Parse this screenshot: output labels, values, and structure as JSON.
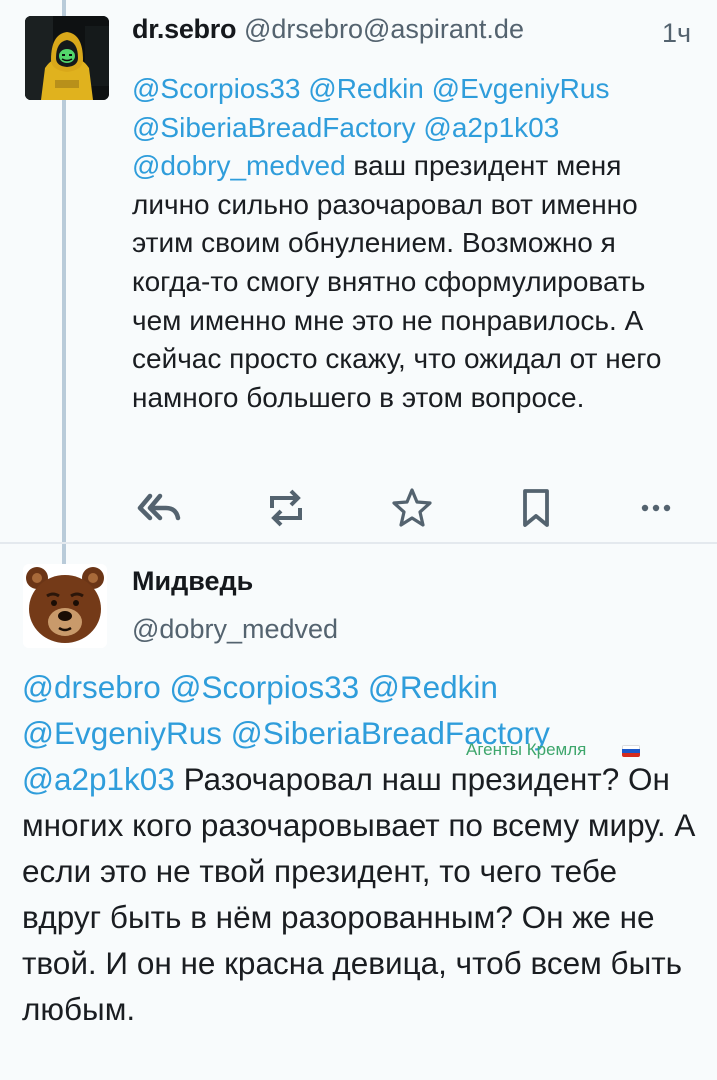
{
  "post": {
    "author_name": "dr.sebro",
    "author_handle": "@drsebro@aspirant.de",
    "time": "1ч",
    "mentions_line1": "@Scorpios33 @Redkin @EvgeniyRus",
    "mentions_line2": "@SiberiaBreadFactory @a2p1k03",
    "mention_inline": "@dobry_medved",
    "text": " ваш президент меня лично сильно разочаровал вот именно этим своим обнулением. Возможно я когда-то смогу внятно сформулировать чем именно мне это не понравилось. А сейчас просто скажу, что ожидал от него намного большего в этом вопросе."
  },
  "actions": {
    "icons": [
      "reply-all-icon",
      "boost-icon",
      "favourite-icon",
      "bookmark-icon",
      "more-icon"
    ]
  },
  "reply": {
    "author_name": "Мидведь",
    "author_handle": "@dobry_medved",
    "mentions_line1": "@drsebro @Scorpios33 @Redkin",
    "mentions_line2": "@EvgeniyRus @SiberiaBreadFactory",
    "mention_inline": "@a2p1k03",
    "text": " Разочаровал наш президент? Он многих кого разочаровывает по всему миру. А если это не твой президент, то чего тебе вдруг быть в нём разорованным? Он же не твой. И он не красна девица, чтоб всем быть любым."
  },
  "watermark": {
    "text": "Агенты Кремля"
  },
  "colors": {
    "mention": "#2f9ddb",
    "icon": "#54636f",
    "thread_line": "#b9cbd9",
    "watermark": "#3ea66c"
  }
}
